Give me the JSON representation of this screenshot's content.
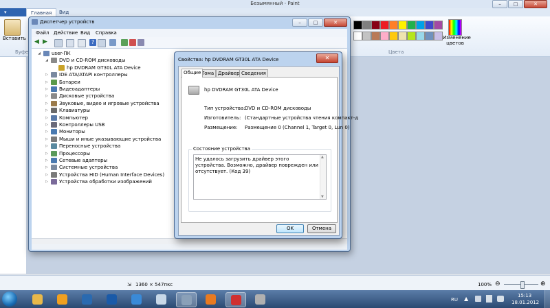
{
  "paint": {
    "title": "Безымянный - Paint",
    "tabs": [
      "Главная",
      "Вид"
    ],
    "paste_label": "Вставить",
    "clipboard_group": "Буфер",
    "colors_group": "Цвета",
    "edit_colors_label_1": "Изменение",
    "edit_colors_label_2": "цветов",
    "image_size": "1360 × 547пкс",
    "zoom": "100%",
    "palette": [
      "#000000",
      "#7f7f7f",
      "#880015",
      "#ed1c24",
      "#ff7f27",
      "#fff200",
      "#22b14c",
      "#00a2e8",
      "#3f48cc",
      "#a349a4",
      "#ffffff",
      "#c3c3c3",
      "#b97a57",
      "#ffaec9",
      "#ffc90e",
      "#efe4b0",
      "#b5e61d",
      "#99d9ea",
      "#7092be",
      "#c8bfe7"
    ]
  },
  "devmgr": {
    "title": "Диспетчер устройств",
    "menu": [
      "Файл",
      "Действие",
      "Вид",
      "Справка"
    ],
    "tree": [
      {
        "label": "user-ПК",
        "level": 0,
        "expanded": true,
        "icon": "computer-icon",
        "color": "#6a88b8"
      },
      {
        "label": "DVD и CD-ROM дисководы",
        "level": 1,
        "expanded": true,
        "icon": "dvd-drive-icon",
        "color": "#8a8a8a"
      },
      {
        "label": "hp DVDRAM GT30L ATA Device",
        "level": 2,
        "expanded": null,
        "icon": "dvd-device-warning-icon",
        "color": "#c9a227"
      },
      {
        "label": "IDE ATA/ATAPI контроллеры",
        "level": 1,
        "expanded": false,
        "icon": "ide-controller-icon",
        "color": "#7a8aa0"
      },
      {
        "label": "Батареи",
        "level": 1,
        "expanded": false,
        "icon": "battery-icon",
        "color": "#5a9a4a"
      },
      {
        "label": "Видеоадаптеры",
        "level": 1,
        "expanded": false,
        "icon": "display-adapter-icon",
        "color": "#4a7ab0"
      },
      {
        "label": "Дисковые устройства",
        "level": 1,
        "expanded": false,
        "icon": "disk-drive-icon",
        "color": "#8a8a8a"
      },
      {
        "label": "Звуковые, видео и игровые устройства",
        "level": 1,
        "expanded": false,
        "icon": "sound-icon",
        "color": "#9a7a4a"
      },
      {
        "label": "Клавиатуры",
        "level": 1,
        "expanded": false,
        "icon": "keyboard-icon",
        "color": "#6a6a6a"
      },
      {
        "label": "Компьютер",
        "level": 1,
        "expanded": false,
        "icon": "computer-icon",
        "color": "#5a7aa8"
      },
      {
        "label": "Контроллеры USB",
        "level": 1,
        "expanded": false,
        "icon": "usb-icon",
        "color": "#6a6a7a"
      },
      {
        "label": "Мониторы",
        "level": 1,
        "expanded": false,
        "icon": "monitor-icon",
        "color": "#4a7ab0"
      },
      {
        "label": "Мыши и иные указывающие устройства",
        "level": 1,
        "expanded": false,
        "icon": "mouse-icon",
        "color": "#7a7a7a"
      },
      {
        "label": "Переносные устройства",
        "level": 1,
        "expanded": false,
        "icon": "portable-device-icon",
        "color": "#5a8aa0"
      },
      {
        "label": "Процессоры",
        "level": 1,
        "expanded": false,
        "icon": "processor-icon",
        "color": "#5a9a5a"
      },
      {
        "label": "Сетевые адаптеры",
        "level": 1,
        "expanded": false,
        "icon": "network-adapter-icon",
        "color": "#4a7ab0"
      },
      {
        "label": "Системные устройства",
        "level": 1,
        "expanded": false,
        "icon": "system-device-icon",
        "color": "#7a8aa0"
      },
      {
        "label": "Устройства HID (Human Interface Devices)",
        "level": 1,
        "expanded": false,
        "icon": "hid-icon",
        "color": "#7a7a7a"
      },
      {
        "label": "Устройства обработки изображений",
        "level": 1,
        "expanded": false,
        "icon": "imaging-device-icon",
        "color": "#7a6a9a"
      }
    ]
  },
  "props": {
    "title": "Свойства: hp DVDRAM GT30L ATA Device",
    "tabs": [
      "Общие",
      "Тома",
      "Драйвер",
      "Сведения"
    ],
    "device_name": "hp DVDRAM GT30L ATA Device",
    "type_label": "Тип устройства:",
    "type_value": "DVD и CD-ROM дисководы",
    "maker_label": "Изготовитель:",
    "maker_value": "(Стандартные устройства чтения компакт-д",
    "location_label": "Размещение:",
    "location_value": "Размещение 0 (Channel 1, Target 0, Lun 0)",
    "status_group": "Состояние устройства",
    "status_text": "Не удалось загрузить драйвер этого устройства. Возможно, драйвер поврежден или отсутствует. (Код 39)",
    "ok": "OK",
    "cancel": "Отмена"
  },
  "taskbar": {
    "apps": [
      {
        "name": "explorer-taskbar-icon",
        "color": "#e8b84a",
        "active": false
      },
      {
        "name": "media-player-taskbar-icon",
        "color": "#f0a020",
        "active": false
      },
      {
        "name": "checkmark-app-taskbar-icon",
        "color": "#2a6ab0",
        "active": false
      },
      {
        "name": "hp-taskbar-icon",
        "color": "#1a5aa8",
        "active": false
      },
      {
        "name": "internet-explorer-taskbar-icon",
        "color": "#3a8ad8",
        "active": false
      },
      {
        "name": "app-taskbar-icon",
        "color": "#c8d8e8",
        "active": false
      },
      {
        "name": "device-manager-taskbar-icon",
        "color": "#8aa0b8",
        "active": true
      },
      {
        "name": "firefox-taskbar-icon",
        "color": "#e87a20",
        "active": false
      },
      {
        "name": "paint-taskbar-icon",
        "color": "#d03030",
        "active": true
      },
      {
        "name": "tools-taskbar-icon",
        "color": "#b0b0b0",
        "active": false
      }
    ],
    "lang": "RU",
    "time": "15:13",
    "date": "18.01.2012"
  }
}
